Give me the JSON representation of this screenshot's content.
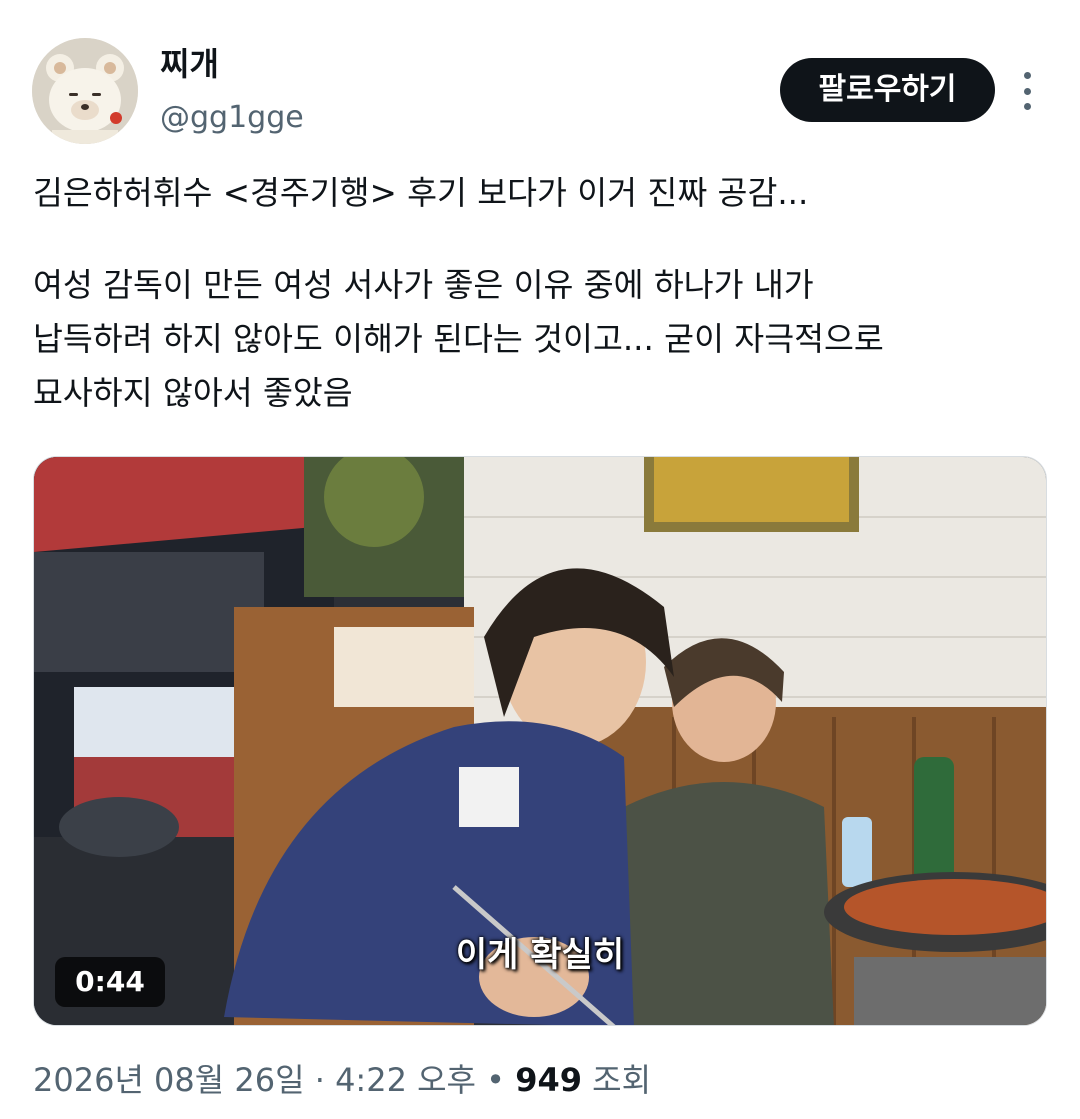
{
  "author": {
    "display_name": "찌개",
    "handle": "@gg1gge"
  },
  "actions": {
    "follow_label": "팔로우하기",
    "more_icon": "more-vertical-icon"
  },
  "tweet": {
    "lines": [
      "김은하허휘수 <경주기행> 후기 보다가 이거 진짜 공감...",
      "여성 감독이 만든 여성 서사가 좋은 이유 중에 하나가 내가",
      "납득하려 하지 않아도 이해가 된다는 것이고... 굳이 자극적으로",
      "묘사하지 않아서 좋았음"
    ]
  },
  "media": {
    "type": "video",
    "subtitle": "이게 확실히",
    "duration": "0:44"
  },
  "meta": {
    "date": "2026년 08월 26일",
    "separator1": " · ",
    "time": "4:22 오후",
    "separator2": " • ",
    "views": "949",
    "views_label": " 조회"
  }
}
